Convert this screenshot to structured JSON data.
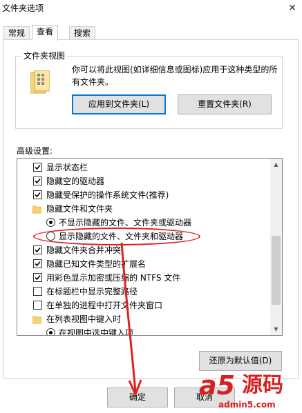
{
  "window": {
    "title": "文件夹选项"
  },
  "tabs": [
    {
      "label": "常规"
    },
    {
      "label": "查看"
    },
    {
      "label": "搜索"
    }
  ],
  "folder_views": {
    "group_label": "文件夹视图",
    "description": "你可以将此视图(如详细信息或图标)应用于这种类型的所有文件夹。",
    "apply_button": "应用到文件夹(L)",
    "reset_button": "重置文件夹(R)"
  },
  "advanced": {
    "label": "高级设置:",
    "items": [
      {
        "type": "checkbox",
        "checked": true,
        "label": "显示状态栏"
      },
      {
        "type": "checkbox",
        "checked": true,
        "label": "隐藏空的驱动器"
      },
      {
        "type": "checkbox",
        "checked": true,
        "label": "隐藏受保护的操作系统文件(推荐)"
      },
      {
        "type": "folder",
        "label": "隐藏文件和文件夹"
      },
      {
        "type": "radio",
        "checked": true,
        "label": "不显示隐藏的文件、文件夹或驱动器"
      },
      {
        "type": "radio",
        "checked": false,
        "label": "显示隐藏的文件、文件夹和驱动器"
      },
      {
        "type": "checkbox",
        "checked": true,
        "label": "隐藏文件夹合并冲突"
      },
      {
        "type": "checkbox",
        "checked": true,
        "label": "隐藏已知文件类型的扩展名"
      },
      {
        "type": "checkbox",
        "checked": true,
        "label": "用彩色显示加密或压缩的 NTFS 文件"
      },
      {
        "type": "checkbox",
        "checked": false,
        "label": "在标题栏中显示完整路径"
      },
      {
        "type": "checkbox",
        "checked": false,
        "label": "在单独的进程中打开文件夹窗口"
      },
      {
        "type": "folder",
        "label": "在列表视图中键入时"
      },
      {
        "type": "radio",
        "checked": true,
        "label": "在视图中选中键入项"
      }
    ],
    "restore_button": "还原为默认值(D)"
  },
  "footer": {
    "ok_button": "确定",
    "cancel_button": "取消"
  },
  "watermark": {
    "brand": "a5",
    "cn": "源码",
    "url": "admin5.com"
  }
}
